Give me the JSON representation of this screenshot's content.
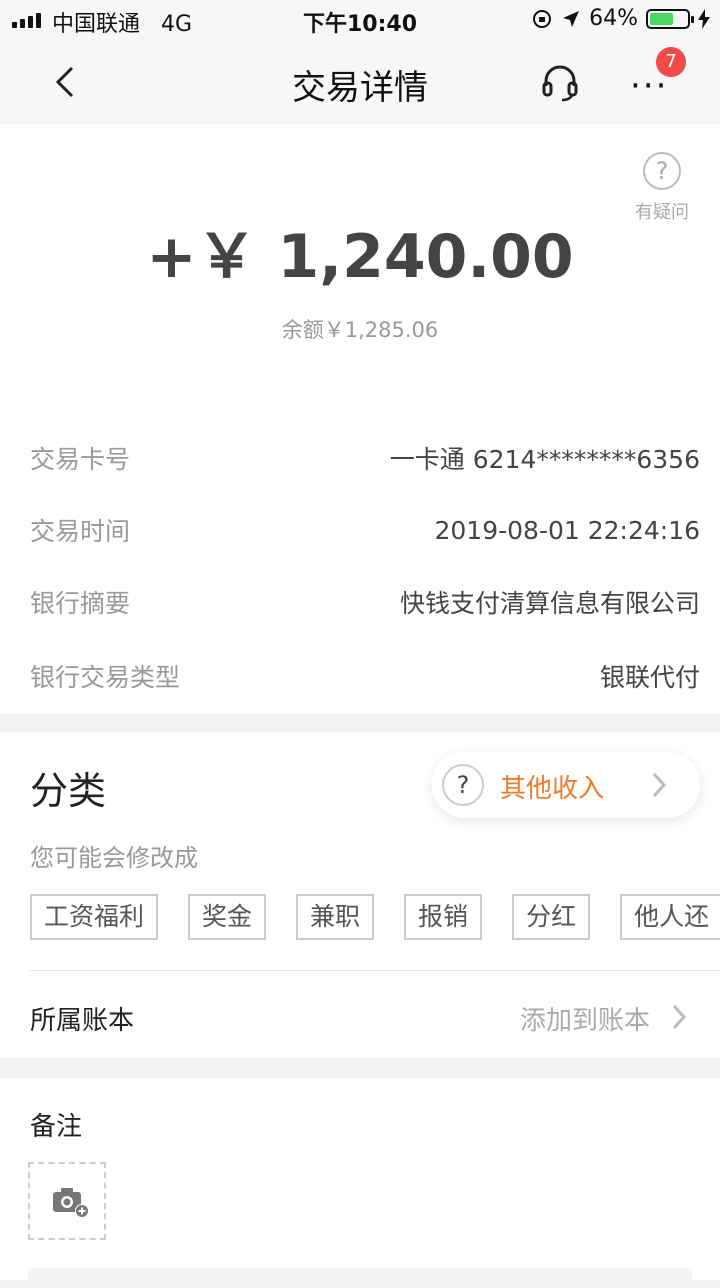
{
  "status_bar": {
    "carrier": "中国联通",
    "network": "4G",
    "time": "下午10:40",
    "battery": "64%",
    "battery_level": 0.64,
    "battery_color": "#4cd964"
  },
  "nav": {
    "title": "交易详情",
    "badge": "7",
    "icons": [
      "chevron-left-icon",
      "headset-icon",
      "more-icon"
    ]
  },
  "summary": {
    "amount": "+￥ 1,240.00",
    "balance": "余额￥1,285.06",
    "help_label": "有疑问"
  },
  "details": [
    {
      "label": "交易卡号",
      "value": "一卡通 6214********6356"
    },
    {
      "label": "交易时间",
      "value": "2019-08-01 22:24:16"
    },
    {
      "label": "银行摘要",
      "value": "快钱支付清算信息有限公司"
    },
    {
      "label": "银行交易类型",
      "value": "银联代付"
    }
  ],
  "category": {
    "title": "分类",
    "current": "其他收入",
    "hint": "您可能会修改成",
    "accent_color": "#f07a2a",
    "suggestions": [
      "工资福利",
      "奖金",
      "兼职",
      "报销",
      "分红",
      "他人还"
    ]
  },
  "ledger": {
    "label": "所属账本",
    "action": "添加到账本"
  },
  "remark": {
    "label": "备注"
  }
}
